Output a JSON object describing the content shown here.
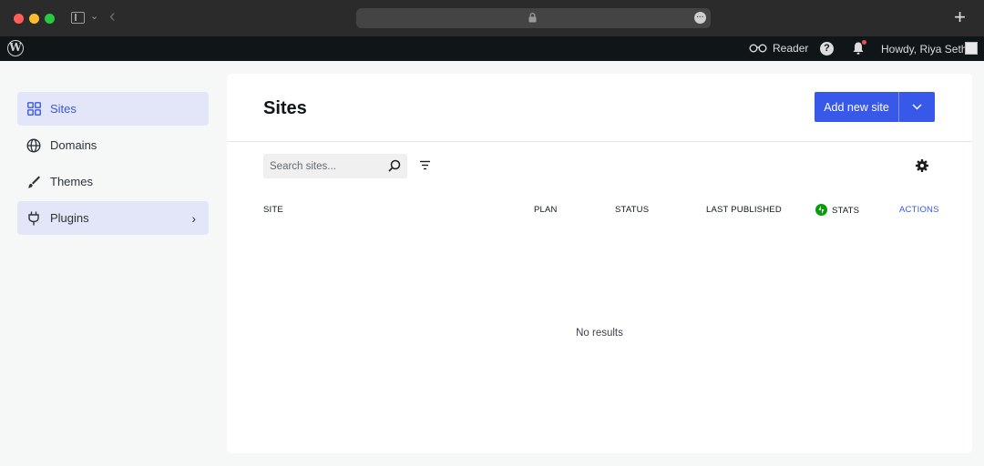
{
  "admin_bar": {
    "logo": "W",
    "reader_label": "Reader",
    "help_glyph": "?",
    "howdy_text": "Howdy, Riya Sethi"
  },
  "nav": {
    "items": [
      {
        "label": "Sites",
        "icon": "grid-icon",
        "state": "active"
      },
      {
        "label": "Domains",
        "icon": "globe-icon",
        "state": "normal"
      },
      {
        "label": "Themes",
        "icon": "brush-icon",
        "state": "normal"
      },
      {
        "label": "Plugins",
        "icon": "plug-icon",
        "state": "hover",
        "chevron": "›"
      }
    ]
  },
  "main": {
    "title": "Sites",
    "add_button_label": "Add new site",
    "search_placeholder": "Search sites...",
    "columns": [
      "SITE",
      "PLAN",
      "STATUS",
      "LAST PUBLISHED",
      "STATS",
      "ACTIONS"
    ],
    "empty_text": "No results"
  },
  "colors": {
    "accent": "#3858e9",
    "stats_green": "#069e08",
    "admin_bar": "#101517",
    "nav_active_bg": "#e3e6f8"
  }
}
